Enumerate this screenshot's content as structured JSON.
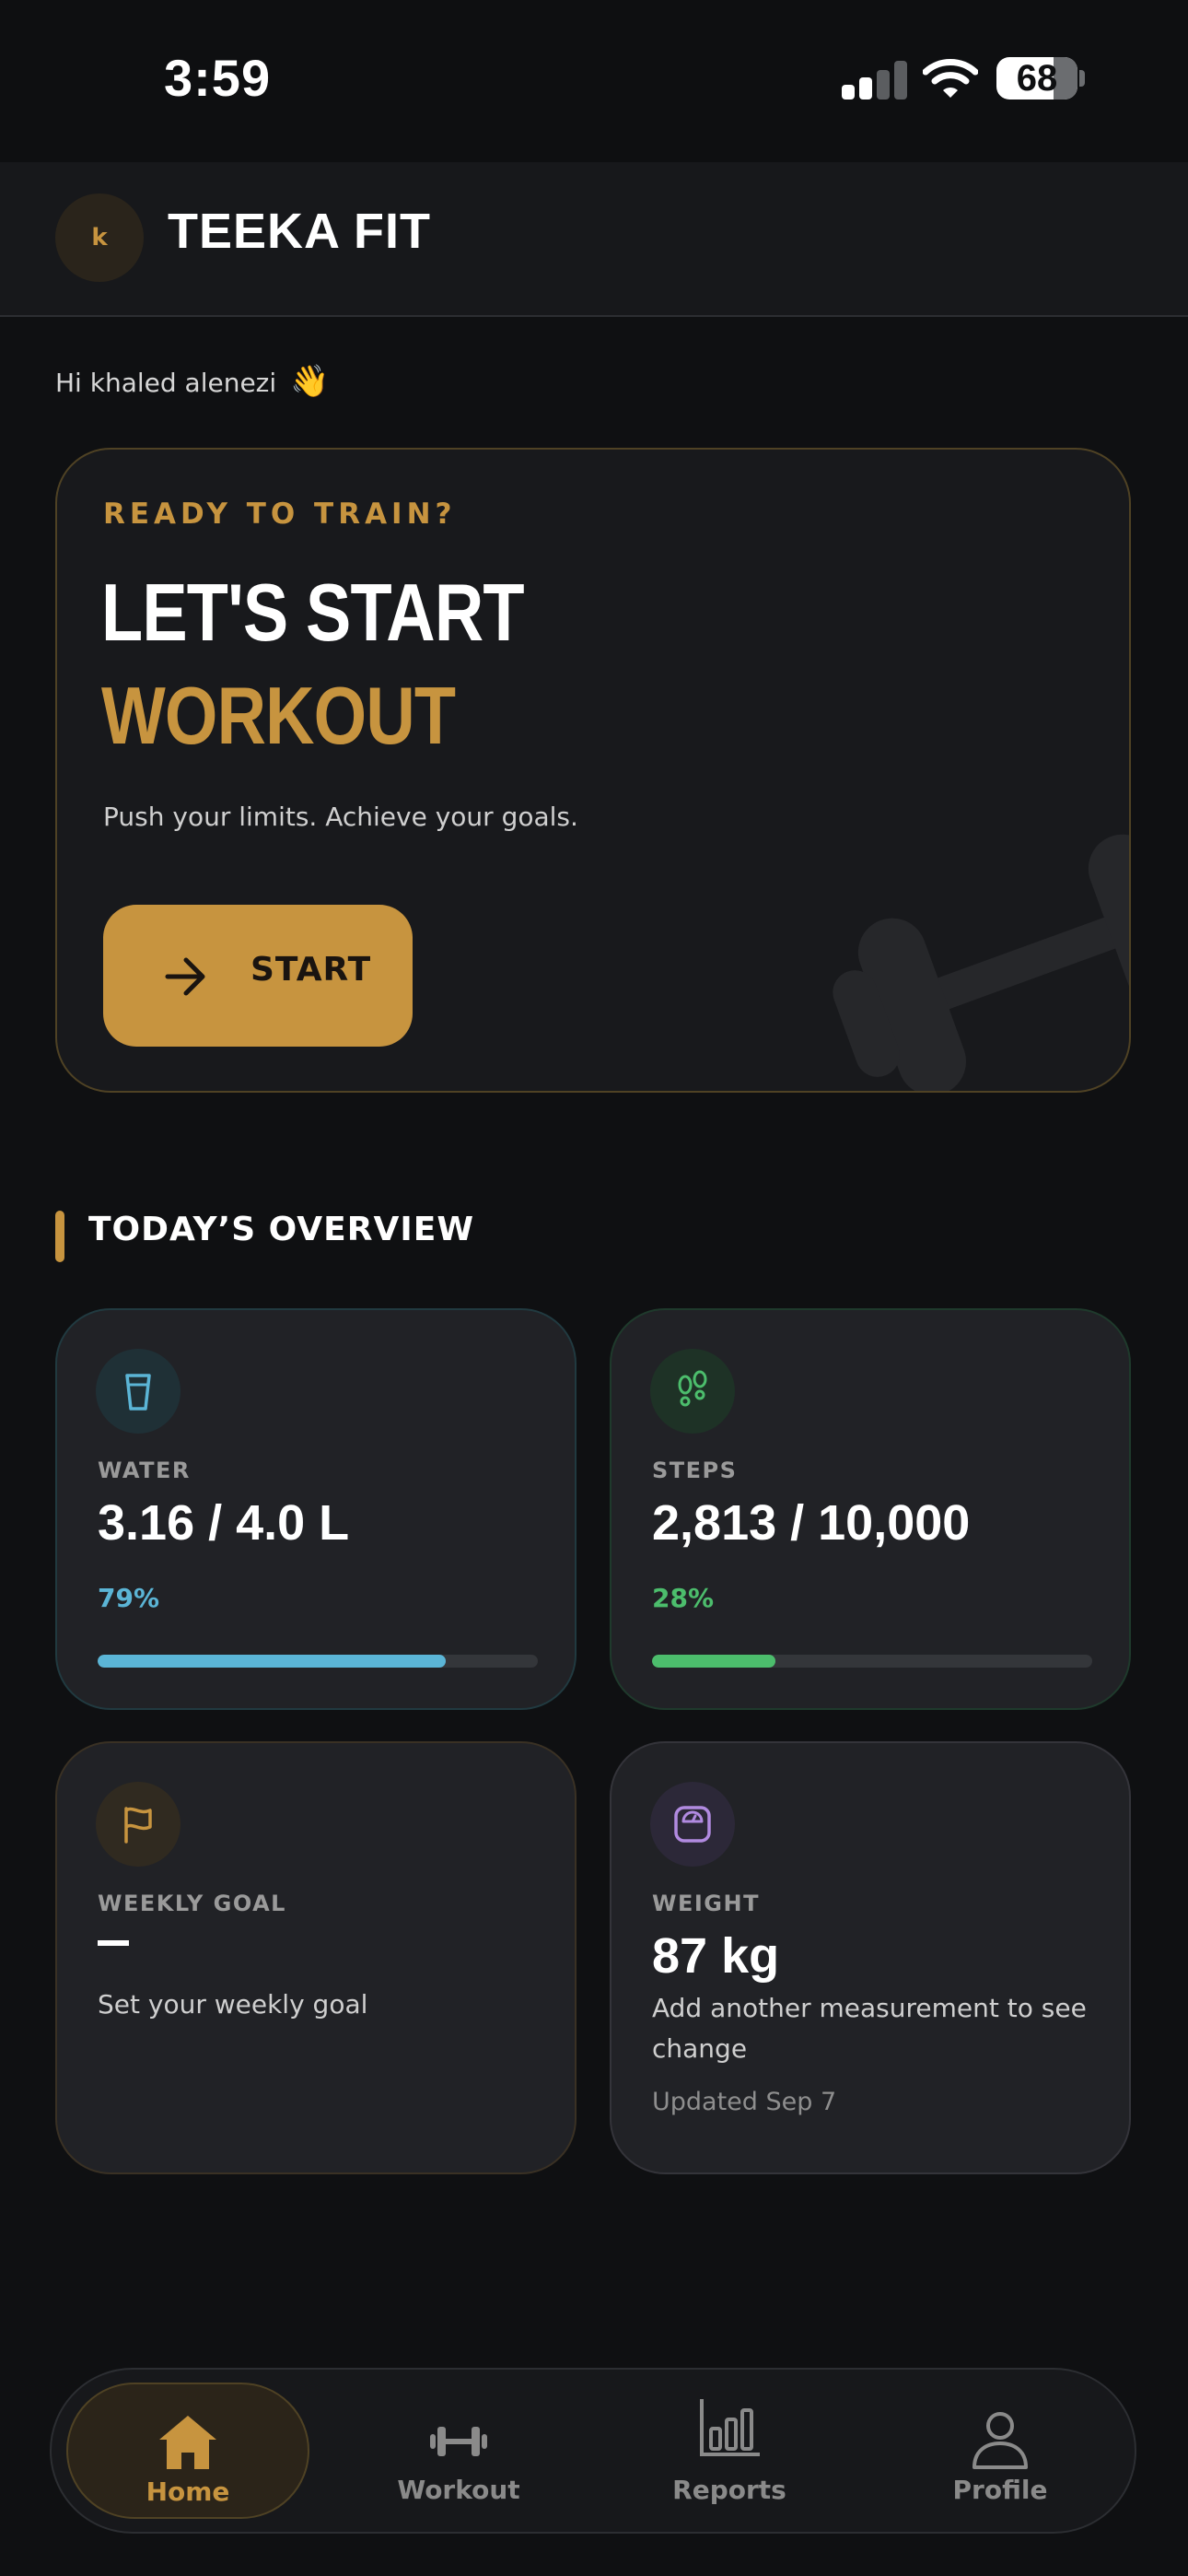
{
  "status_bar": {
    "time": "3:59",
    "battery": "68"
  },
  "header": {
    "avatar_initial": "k",
    "title": "TEEKA FIT"
  },
  "greeting": {
    "text": "Hi khaled alenezi",
    "emoji": "👋"
  },
  "hero": {
    "eyebrow": "READY TO TRAIN?",
    "line1": "LET'S START",
    "line2": "WORKOUT",
    "subtitle": "Push your limits. Achieve your goals.",
    "button_label": "START"
  },
  "overview": {
    "title": "TODAY’S OVERVIEW",
    "water": {
      "label": "WATER",
      "value": "3.16 / 4.0 L",
      "percent": "79%",
      "progress": 0.79,
      "color": "#5bb5d6",
      "icon": "water-glass-icon"
    },
    "steps": {
      "label": "STEPS",
      "value": "2,813 / 10,000",
      "percent": "28%",
      "progress": 0.28,
      "color": "#4cbd6c",
      "icon": "footprints-icon"
    },
    "weekly_goal": {
      "label": "WEEKLY GOAL",
      "value": "—",
      "note": "Set your weekly goal",
      "icon": "flag-icon"
    },
    "weight": {
      "label": "WEIGHT",
      "value": "87 kg",
      "note": "Add another measurement to see change",
      "updated": "Updated Sep 7",
      "icon": "scale-icon"
    }
  },
  "tabs": [
    {
      "label": "Home",
      "icon": "home-icon",
      "active": true
    },
    {
      "label": "Workout",
      "icon": "dumbbell-icon",
      "active": false
    },
    {
      "label": "Reports",
      "icon": "bar-chart-icon",
      "active": false
    },
    {
      "label": "Profile",
      "icon": "person-icon",
      "active": false
    }
  ],
  "colors": {
    "accent": "#c7943f",
    "background": "#0f1012",
    "card": "#212226"
  }
}
